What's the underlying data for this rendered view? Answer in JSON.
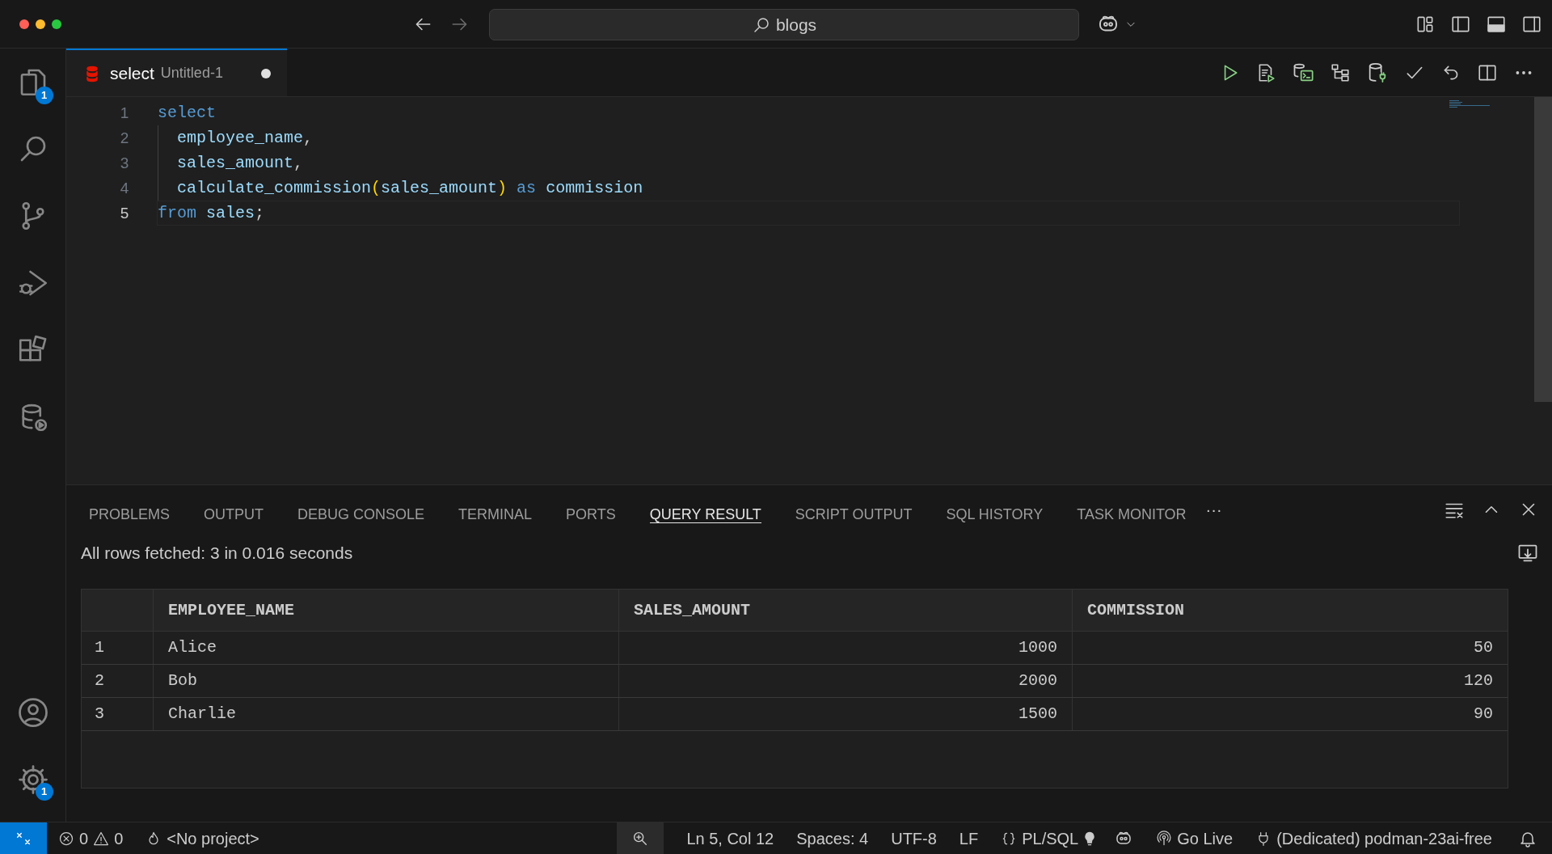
{
  "title_bar": {
    "search": "blogs"
  },
  "activity_bar": {
    "explorer_badge": "1",
    "settings_badge": "1"
  },
  "editor_tab": {
    "label": "select",
    "description": "Untitled-1",
    "modified": true,
    "selected": true
  },
  "code_lines": [
    {
      "number": "1",
      "current": false,
      "tokens": [
        {
          "kind": "keyword",
          "text": "select"
        }
      ]
    },
    {
      "number": "2",
      "current": false,
      "indented": true,
      "tokens": [
        {
          "kind": "identifier",
          "text": "employee_name"
        },
        {
          "kind": "punct",
          "text": ","
        }
      ]
    },
    {
      "number": "3",
      "current": false,
      "indented": true,
      "tokens": [
        {
          "kind": "identifier",
          "text": "sales_amount"
        },
        {
          "kind": "punct",
          "text": ","
        }
      ]
    },
    {
      "number": "4",
      "current": false,
      "indented": true,
      "tokens": [
        {
          "kind": "identifier",
          "text": "calculate_commission"
        },
        {
          "kind": "bracket",
          "text": "("
        },
        {
          "kind": "identifier",
          "text": "sales_amount"
        },
        {
          "kind": "bracket",
          "text": ")"
        },
        {
          "kind": "keyword",
          "text": " as"
        },
        {
          "kind": "identifier",
          "text": " commission"
        }
      ]
    },
    {
      "number": "5",
      "current": true,
      "tokens": [
        {
          "kind": "keyword",
          "text": "from"
        },
        {
          "kind": "identifier",
          "text": " sales"
        },
        {
          "kind": "punct",
          "text": ";"
        }
      ]
    }
  ],
  "panel_tabs": [
    {
      "label": "PROBLEMS",
      "selected": false
    },
    {
      "label": "OUTPUT",
      "selected": false
    },
    {
      "label": "DEBUG CONSOLE",
      "selected": false
    },
    {
      "label": "TERMINAL",
      "selected": false
    },
    {
      "label": "PORTS",
      "selected": false
    },
    {
      "label": "QUERY RESULT",
      "selected": true
    },
    {
      "label": "SCRIPT OUTPUT",
      "selected": false
    },
    {
      "label": "SQL HISTORY",
      "selected": false
    },
    {
      "label": "TASK MONITOR",
      "selected": false
    }
  ],
  "panel_more": "···",
  "query_result": {
    "summary": "All rows fetched: 3 in 0.016 seconds",
    "columns": [
      "EMPLOYEE_NAME",
      "SALES_AMOUNT",
      "COMMISSION"
    ],
    "rows": [
      {
        "number": "1",
        "cells": [
          "Alice",
          "1000",
          "50"
        ]
      },
      {
        "number": "2",
        "cells": [
          "Bob",
          "2000",
          "120"
        ]
      },
      {
        "number": "3",
        "cells": [
          "Charlie",
          "1500",
          "90"
        ]
      }
    ]
  },
  "status_bar": [
    {
      "kind": "errors",
      "text": "0"
    },
    {
      "kind": "warnings",
      "text": "0"
    },
    {
      "kind": "project",
      "text": "<No project>"
    },
    {
      "kind": "zoom"
    },
    {
      "kind": "plain",
      "text": "Ln 5, Col 12"
    },
    {
      "kind": "plain",
      "text": "Spaces: 4"
    },
    {
      "kind": "plain",
      "text": "UTF-8"
    },
    {
      "kind": "plain",
      "text": "LF"
    },
    {
      "kind": "language",
      "text": "PL/SQL"
    },
    {
      "kind": "copilot"
    },
    {
      "kind": "live",
      "text": "Go Live"
    },
    {
      "kind": "connection",
      "text": "(Dedicated) podman-23ai-free"
    }
  ]
}
